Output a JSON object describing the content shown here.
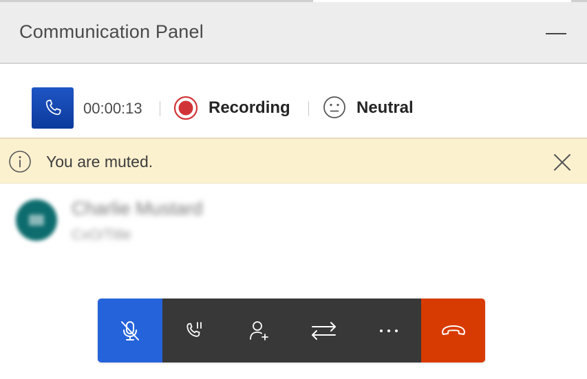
{
  "panel": {
    "title": "Communication Panel"
  },
  "call": {
    "duration": "00:00:13",
    "recording_label": "Recording",
    "sentiment_label": "Neutral"
  },
  "banner": {
    "message": "You are muted."
  },
  "contact": {
    "name": "Charlie Mustard",
    "role": "CxO/Title"
  },
  "controls": [
    {
      "id": "mute",
      "icon": "mic-off-icon",
      "active": true
    },
    {
      "id": "hold",
      "icon": "call-hold-icon"
    },
    {
      "id": "add-participant",
      "icon": "person-add-icon"
    },
    {
      "id": "transfer",
      "icon": "transfer-icon"
    },
    {
      "id": "more",
      "icon": "more-icon"
    },
    {
      "id": "end-call",
      "icon": "hang-up-icon"
    }
  ],
  "colors": {
    "header_bg": "#ededed",
    "call_icon_bg": "#1e55c4",
    "recording_red": "#d13438",
    "banner_bg": "#fcf1cf",
    "mute_active": "#2563db",
    "controls_bg": "#383838",
    "end_call": "#d83b01"
  }
}
